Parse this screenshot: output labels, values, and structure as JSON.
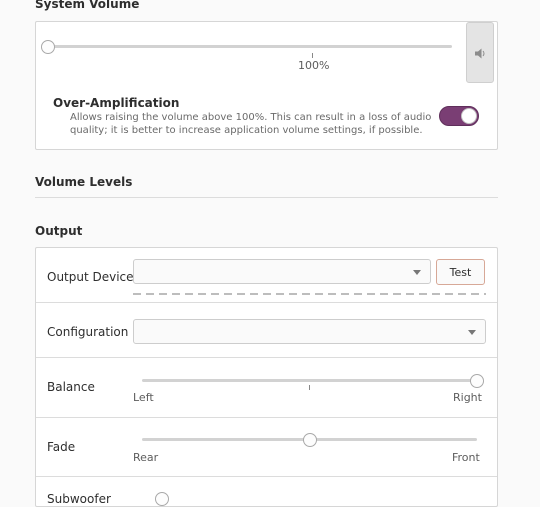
{
  "system_volume": {
    "title": "System Volume",
    "slider_value_percent": 0,
    "tick_label": "100%",
    "mute_icon": "speaker-icon",
    "over_amplification": {
      "title": "Over-Amplification",
      "description_line1": "Allows raising the volume above 100%. This can result in a loss of audio",
      "description_line2": "quality; it is better to increase application volume settings, if possible.",
      "enabled": true
    }
  },
  "volume_levels": {
    "title": "Volume Levels"
  },
  "output": {
    "title": "Output",
    "output_device": {
      "label": "Output Device",
      "value": "",
      "test_label": "Test"
    },
    "configuration": {
      "label": "Configuration",
      "value": ""
    },
    "balance": {
      "label": "Balance",
      "left_label": "Left",
      "right_label": "Right",
      "value": 1.0
    },
    "fade": {
      "label": "Fade",
      "left_label": "Rear",
      "right_label": "Front",
      "value": 0.5
    },
    "subwoofer": {
      "label": "Subwoofer"
    }
  },
  "colors": {
    "accent": "#7a3e74",
    "test_border": "#d7a897"
  }
}
